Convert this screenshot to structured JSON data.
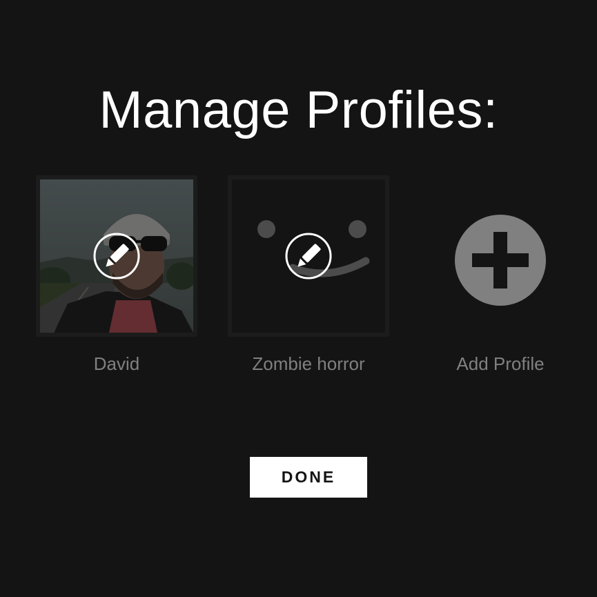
{
  "header": {
    "title": "Manage Profiles:"
  },
  "profiles": [
    {
      "name": "David",
      "avatar": "photo-avatar",
      "editable": true
    },
    {
      "name": "Zombie horror",
      "avatar": "smiley-avatar",
      "editable": true
    },
    {
      "name": "Add Profile",
      "avatar": "plus-icon",
      "editable": false
    }
  ],
  "actions": {
    "done_label": "DONE"
  },
  "colors": {
    "background": "#141414",
    "title": "#ffffff",
    "label": "#808080",
    "add_circle": "#808080",
    "avatar_tile": "#262626"
  }
}
